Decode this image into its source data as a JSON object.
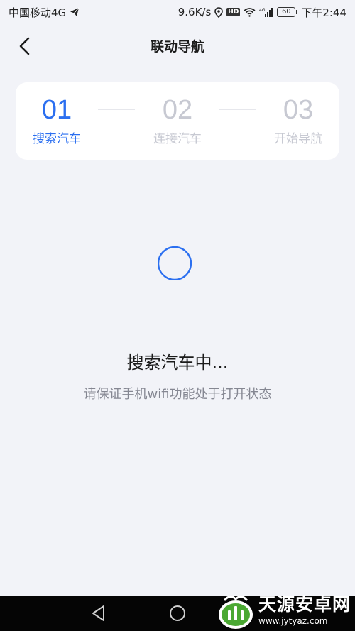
{
  "status_bar": {
    "carrier": "中国移动4G",
    "speed": "9.6K/s",
    "hd": "HD",
    "network_type": "4G",
    "battery": "60",
    "time": "下午2:44"
  },
  "header": {
    "title": "联动导航",
    "back_icon": "chevron-left-icon"
  },
  "steps": [
    {
      "number": "01",
      "label": "搜索汽车",
      "active": true
    },
    {
      "number": "02",
      "label": "连接汽车",
      "active": false
    },
    {
      "number": "03",
      "label": "开始导航",
      "active": false
    }
  ],
  "loading": {
    "title": "搜索汽车中...",
    "hint": "请保证手机wifi功能处于打开状态"
  },
  "colors": {
    "accent": "#2b6ff0",
    "inactive": "#c7c9d2",
    "background": "#f2f3f8",
    "card": "#ffffff"
  },
  "watermark": {
    "main": "天源安卓网",
    "sub": "www.jytyaz.com"
  }
}
